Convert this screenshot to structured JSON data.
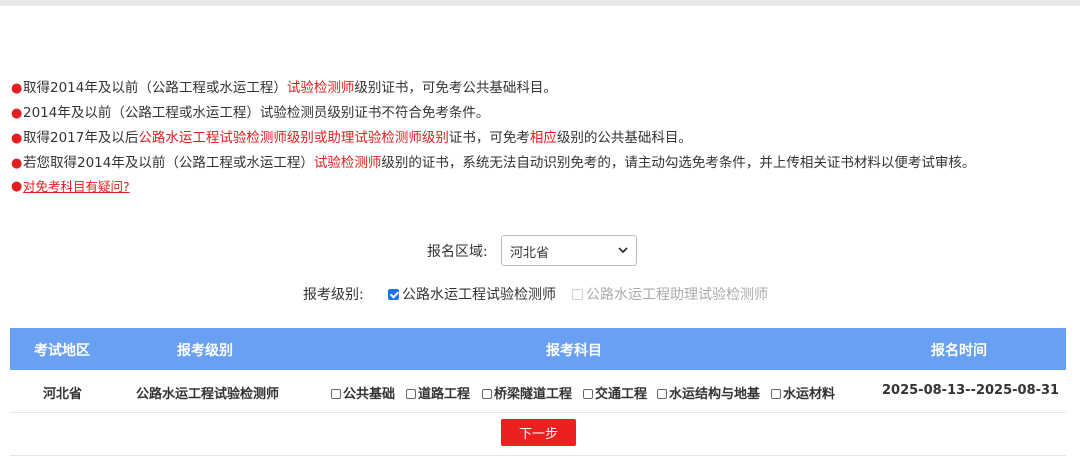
{
  "notes": {
    "n1": {
      "a": "取得2014年及以前（公路工程或水运工程）",
      "b": "试验检测师",
      "c": "级别证书，可免考公共基础科目。"
    },
    "n2": {
      "a": "2014年及以前（公路工程或水运工程）试验检测员级别证书不符合免考条件。"
    },
    "n3": {
      "a": "取得2017年及以后",
      "b": "公路水运工程试验检测师级别或助理试验检测师级别",
      "c": "证书，可免考",
      "d": "相应",
      "e": "级别的公共基础科目。"
    },
    "n4": {
      "a": "若您取得2014年及以前（公路工程或水运工程）",
      "b": "试验检测师",
      "c": "级别的证书，系统无法自动识别免考的，请主动勾选免考条件，并上传相关证书材料以便考试审核。"
    },
    "faq_link": "对免考科目有疑问?"
  },
  "region": {
    "label": "报名区域:",
    "selected": "河北省"
  },
  "level": {
    "label": "报考级别:",
    "options": [
      {
        "label": "公路水运工程试验检测师",
        "checked": true,
        "disabled": false
      },
      {
        "label": "公路水运工程助理试验检测师",
        "checked": false,
        "disabled": true
      }
    ]
  },
  "table": {
    "headers": [
      "考试地区",
      "报考级别",
      "报考科目",
      "报名时间"
    ],
    "row": {
      "region": "河北省",
      "level": "公路水运工程试验检测师",
      "subjects": [
        "公共基础",
        "道路工程",
        "桥梁隧道工程",
        "交通工程",
        "水运结构与地基",
        "水运材料"
      ],
      "time": "2025-08-13--2025-08-31"
    }
  },
  "next_button": "下一步",
  "colors": {
    "accent_red": "#e02020",
    "table_header": "#6aa0f2",
    "button_red": "#ee1f1f",
    "checkbox_blue": "#1a73e8"
  }
}
